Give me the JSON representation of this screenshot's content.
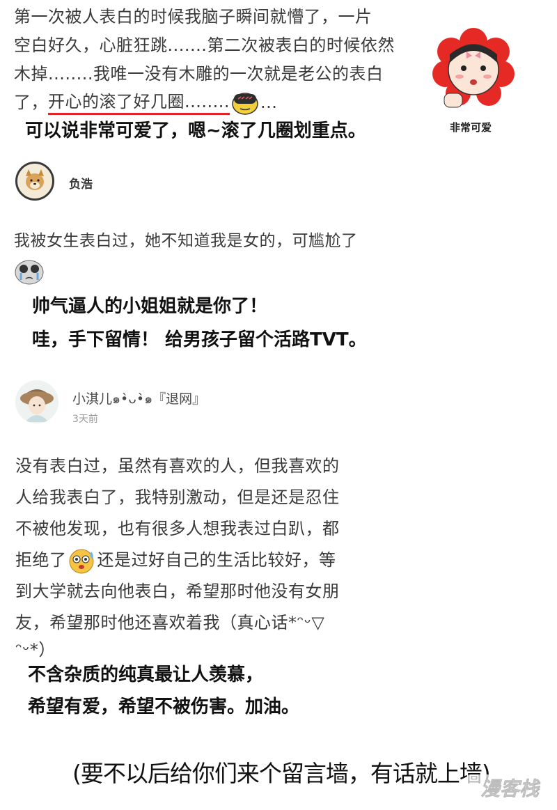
{
  "comment1": {
    "line1": "第一次被人表白的时候我脑子瞬间就懵了，一片",
    "line2": "空白好久，心脏狂跳.......第二次被表白的时候依然",
    "line3": "木掉........我唯一没有木雕的一次就是老公的表白",
    "line4_prefix": "了，",
    "line4_highlight": "开心的滚了好几圈........",
    "line4_suffix": "..."
  },
  "caption1": "可以说非常可爱了，嗯~滚了几圈划重点。",
  "sticker_label": "非常可爱",
  "user2": {
    "name": "负浩"
  },
  "comment2": "我被女生表白过，她不知道我是女的，可尴尬了",
  "caption2": {
    "line1": "帅气逼人的小姐姐就是你了！",
    "line2": "哇，手下留情！ 给男孩子留个活路TVT。"
  },
  "user3": {
    "name": "小淇儿๑•̀ᴗ•̀๑『退网』",
    "time": "3天前"
  },
  "comment3": {
    "line1": "没有表白过，虽然有喜欢的人，但我喜欢的",
    "line2": "人给我表白了，我特别激动，但是还是忍住",
    "line3": "不被他发现，也有很多人想我表过白趴，都",
    "line4_prefix": "拒绝了",
    "line4_suffix": "还是过好自己的生活比较好，等",
    "line5": "到大学就去向他表白，希望那时他没有女朋",
    "line6": "友，希望那时他还喜欢着我（真心话*ᵔᵕ▽",
    "line7": "ᵔᵕ*）"
  },
  "caption3": {
    "line1": "不含杂质的纯真最让人羡慕，",
    "line2": "希望有爱，希望不被伤害。加油。"
  },
  "footer_note": "(要不以后给你们来个留言墙，有话就上墙)",
  "watermark": "漫客栈",
  "colors": {
    "underline": "#e0262b",
    "sticker_petal": "#e52a26",
    "text": "#3a3a3a"
  },
  "icons": [
    "embarrassed-emoji-icon",
    "tearful-emoji-icon",
    "shocked-emoji-icon",
    "doge-avatar",
    "girl-avatar",
    "cute-sticker"
  ]
}
